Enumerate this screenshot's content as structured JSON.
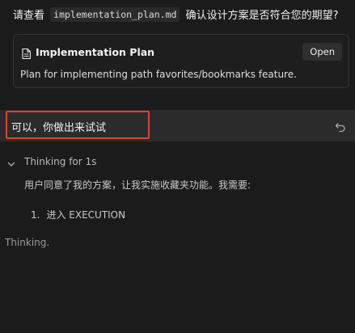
{
  "message": {
    "prefix": "请查看",
    "filename": "implementation_plan.md",
    "suffix": "确认设计方案是否符合您的期望?"
  },
  "plan_card": {
    "icon": "document-icon",
    "title": "Implementation Plan",
    "open_label": "Open",
    "description": "Plan for implementing path favorites/bookmarks feature."
  },
  "reply": {
    "text": "可以，你做出来试试",
    "undo_icon": "undo-icon",
    "highlight_color": "#d9452b"
  },
  "thinking": {
    "chevron_icon": "chevron-down-icon",
    "label": "Thinking for 1s",
    "body": "用户同意了我的方案，让我实施收藏夹功能。我需要:",
    "steps": [
      {
        "num": "1.",
        "text": "进入 EXECUTION"
      }
    ]
  },
  "status": {
    "text": "Thinking."
  }
}
